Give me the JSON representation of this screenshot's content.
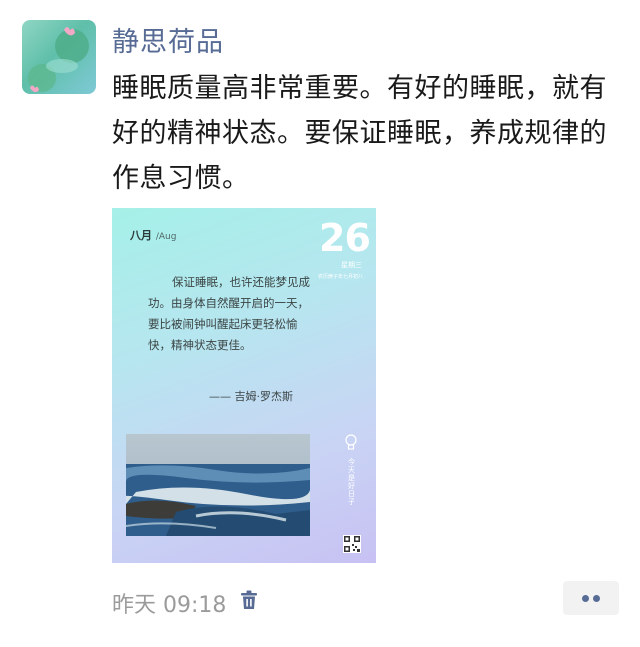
{
  "post": {
    "author": "静思荷品",
    "text": "睡眠质量高非常重要。有好的睡眠，就有好的精神状态。要保证睡眠，养成规律的作息习惯。",
    "time": "昨天 09:18"
  },
  "card": {
    "month": "八月",
    "month_en": "/Aug",
    "day": "26",
    "weekday": "星期三",
    "lunar": "农历庚子年七月初八",
    "quote": "保证睡眠，也许还能梦见成功。由身体自然醒开启的一天，要比被闹钟叫醒起床更轻松愉快，精神状态更佳。",
    "author": "—— 吉姆·罗杰斯",
    "side_text": "今天是好日子"
  },
  "colors": {
    "link": "#576b95",
    "meta": "#9b9b9b",
    "card_gradient_start": "#a5f0e8",
    "card_gradient_end": "#c7c1f3"
  },
  "icons": {
    "trash": "trash-icon",
    "more": "more-dots-icon"
  }
}
